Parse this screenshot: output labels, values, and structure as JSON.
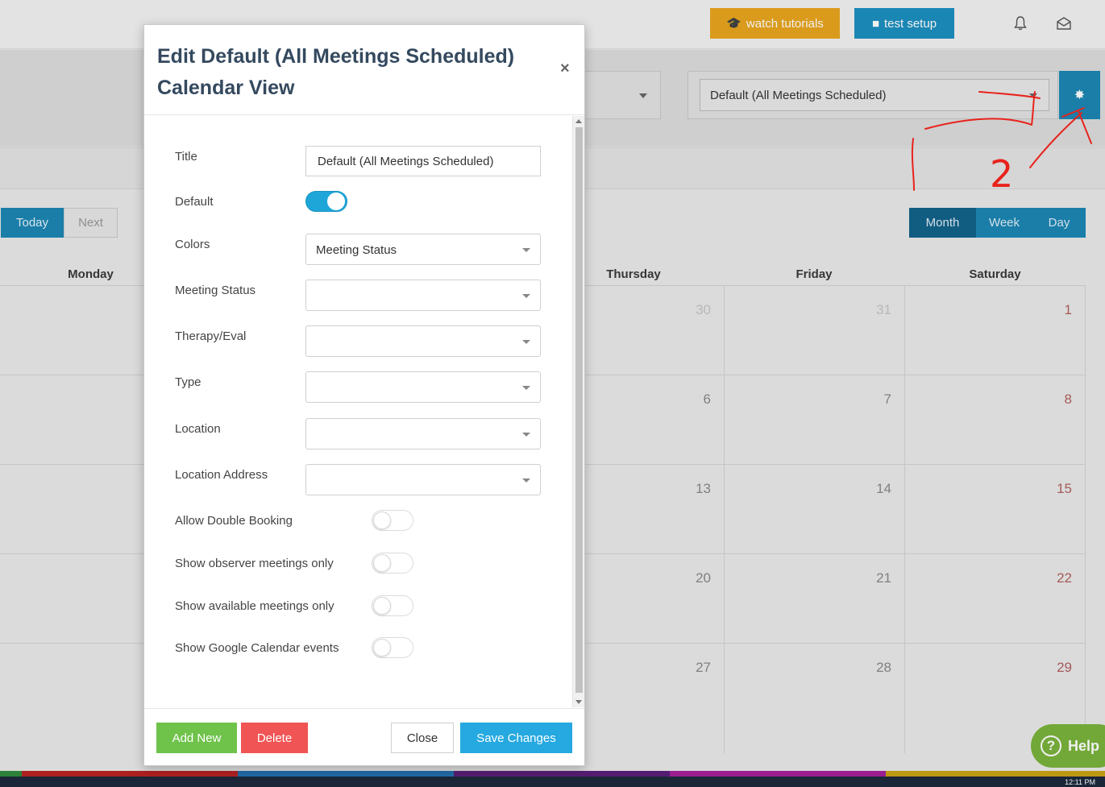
{
  "topbar": {
    "tutorials_label": "watch tutorials",
    "setup_label": "test setup",
    "tutorials_icon": "graduation-cap-icon",
    "setup_icon": "video-camera-icon",
    "bell_icon": "bell-icon",
    "inbox_icon": "envelope-icon"
  },
  "filters": {
    "view_selected": "Default (All Meetings Scheduled)",
    "gear_icon": "gear-icon"
  },
  "calendar": {
    "today_label": "Today",
    "next_label": "Next",
    "views": [
      "Month",
      "Week",
      "Day"
    ],
    "active_view": "Month",
    "day_headers": [
      "Monday",
      "Thursday",
      "Friday",
      "Saturday"
    ],
    "weeks": [
      {
        "thu": "30",
        "fri": "31",
        "sat": "1"
      },
      {
        "thu": "6",
        "fri": "7",
        "sat": "8"
      },
      {
        "thu": "13",
        "fri": "14",
        "sat": "15"
      },
      {
        "thu": "20",
        "fri": "21",
        "sat": "22"
      },
      {
        "thu": "27",
        "fri": "28",
        "sat": "29"
      }
    ]
  },
  "help": {
    "label": "Help"
  },
  "taskbar": {
    "time": "12:11 PM"
  },
  "modal": {
    "title": "Edit Default (All Meetings Scheduled) Calendar View",
    "close_symbol": "×",
    "fields": {
      "title_label": "Title",
      "title_value": "Default (All Meetings Scheduled)",
      "default_label": "Default",
      "default_on": true,
      "colors_label": "Colors",
      "colors_value": "Meeting Status",
      "meeting_status_label": "Meeting Status",
      "meeting_status_value": "",
      "therapy_label": "Therapy/Eval",
      "therapy_value": "",
      "type_label": "Type",
      "type_value": "",
      "location_label": "Location",
      "location_value": "",
      "location_address_label": "Location Address",
      "location_address_value": "",
      "double_booking_label": "Allow Double Booking",
      "double_booking_on": false,
      "observer_label": "Show observer meetings only",
      "observer_on": false,
      "available_label": "Show available meetings only",
      "available_on": false,
      "google_label": "Show Google Calendar events",
      "google_on": false
    },
    "footer": {
      "add_label": "Add New",
      "delete_label": "Delete",
      "close_label": "Close",
      "save_label": "Save Changes"
    }
  },
  "annotation": {
    "number_label": "2",
    "color": "#e8231c"
  },
  "colors": {
    "primary": "#1c86b4",
    "warning": "#e8a51e",
    "success": "#6fc24a",
    "danger": "#f05454",
    "info": "#25a9e0"
  }
}
